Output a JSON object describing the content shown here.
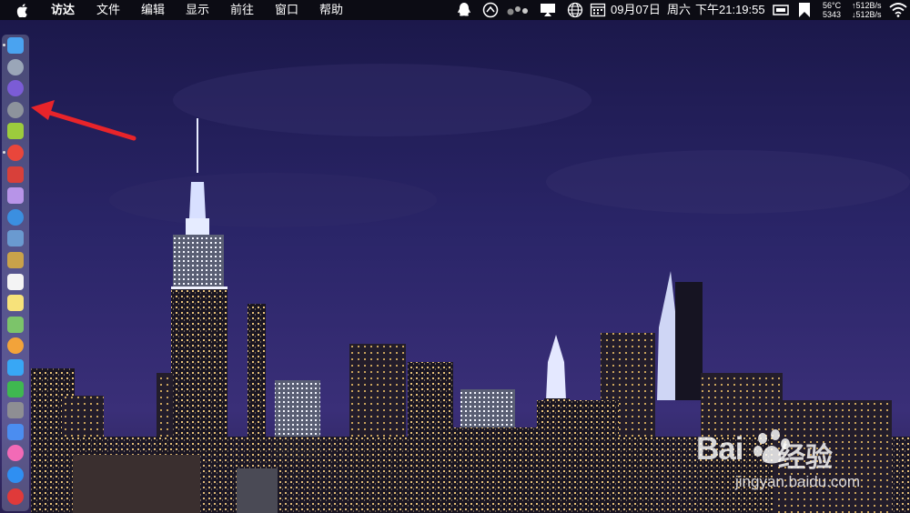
{
  "menubar": {
    "apple_icon": "apple-icon",
    "items": [
      "访达",
      "文件",
      "编辑",
      "显示",
      "前往",
      "窗口",
      "帮助"
    ],
    "status": {
      "date": "09月07日",
      "weekday": "周六",
      "time": "下午21:19:55",
      "temperature": "56°C",
      "fan": "5343",
      "upload": "↑512B/s",
      "download": "↓512B/s"
    }
  },
  "dock": {
    "apps": [
      {
        "name": "finder-icon",
        "color": "#4aa3f0"
      },
      {
        "name": "launchpad-icon",
        "color": "#9aa6b8"
      },
      {
        "name": "siri-icon",
        "color": "#7b5cd6"
      },
      {
        "name": "sogou-app-icon",
        "color": "#8d939c"
      },
      {
        "name": "android-icon",
        "color": "#9ccc3d"
      },
      {
        "name": "chrome-icon",
        "color": "#e9463b"
      },
      {
        "name": "filezilla-icon",
        "color": "#d8403a"
      },
      {
        "name": "disk-utility-icon",
        "color": "#b794e8"
      },
      {
        "name": "safari-icon",
        "color": "#3b8fe0"
      },
      {
        "name": "preview-icon",
        "color": "#6a9ad0"
      },
      {
        "name": "notebook-icon",
        "color": "#c9a24a"
      },
      {
        "name": "calendar-icon",
        "color": "#f4f4f4"
      },
      {
        "name": "notes-icon",
        "color": "#f7e27a"
      },
      {
        "name": "maps-icon",
        "color": "#7cc46a"
      },
      {
        "name": "photos-icon",
        "color": "#f2a33a"
      },
      {
        "name": "messages-icon",
        "color": "#38a7f5"
      },
      {
        "name": "facetime-icon",
        "color": "#3fb850"
      },
      {
        "name": "system-preferences-icon",
        "color": "#8e8e93"
      },
      {
        "name": "keynote-icon",
        "color": "#4b8df0"
      },
      {
        "name": "itunes-icon",
        "color": "#f26ab6"
      },
      {
        "name": "app-store-icon",
        "color": "#2f8ff2"
      },
      {
        "name": "vivaldi-icon",
        "color": "#e03a3a"
      }
    ]
  },
  "watermark": {
    "brand": "Bai",
    "suffix": "经验",
    "url": "jingyan.baidu.com"
  },
  "colors": {
    "arrow": "#e8242a",
    "menubar": "#0c0c14",
    "sky": "#2a2568"
  }
}
